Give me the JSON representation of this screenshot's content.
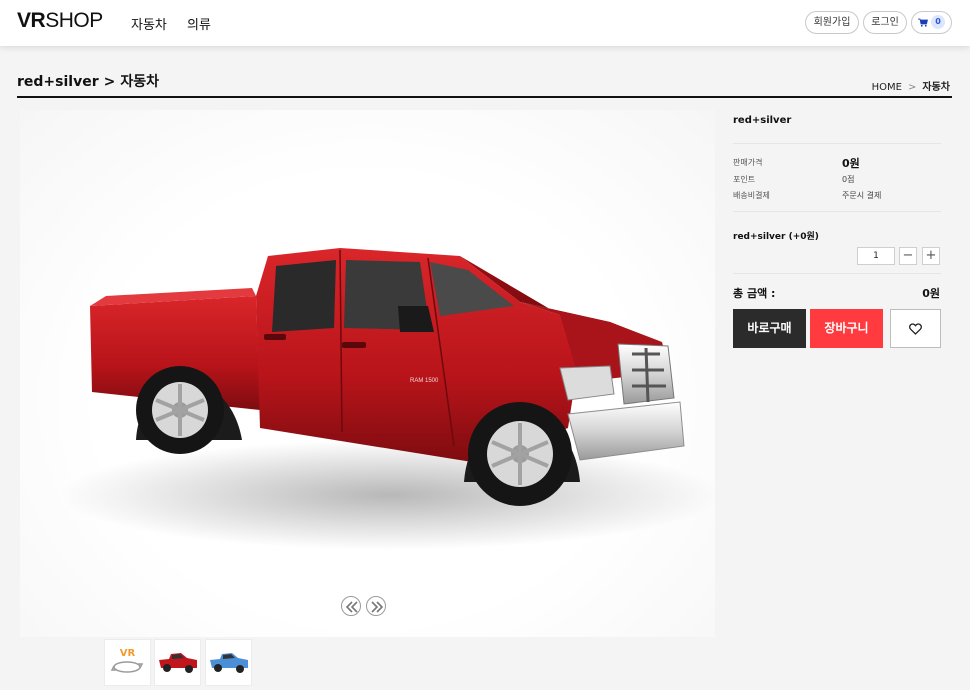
{
  "header": {
    "logo_bold": "VR",
    "logo_light": "SHOP",
    "nav": [
      "자동차",
      "의류"
    ],
    "join_label": "회원가입",
    "login_label": "로그인",
    "cart_count": "0"
  },
  "title_bar": {
    "option": "red+silver",
    "separator": ">",
    "category": "자동차",
    "breadcrumb": {
      "home": "HOME",
      "separator": ">",
      "current": "자동차"
    }
  },
  "product": {
    "name": "red+silver",
    "price_label": "판매가격",
    "price_value": "0원",
    "points_label": "포인트",
    "points_value": "0점",
    "shipping_label": "배송비결제",
    "shipping_value": "주문시 결제",
    "selected_option": "red+silver (+0원)",
    "quantity": "1",
    "total_label": "총 금액 :",
    "total_value": "0원",
    "buy_now_label": "바로구매",
    "add_cart_label": "장바구니"
  },
  "thumbnails": {
    "vr_label": "VR",
    "colors": [
      "#c0161c",
      "#4b8fd6"
    ]
  },
  "colors": {
    "car_red": "#c0161c",
    "buy_button": "#2b2b2b",
    "cart_button": "#ff3b3f"
  }
}
